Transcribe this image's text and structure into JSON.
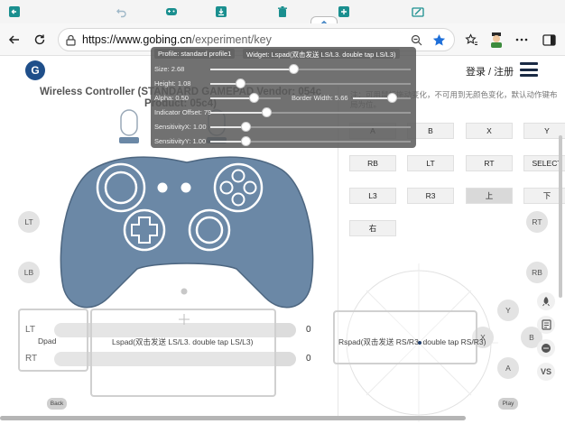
{
  "toolbar": {
    "icons": [
      "back-arrow-icon",
      "undo-icon",
      "gamepad-icon",
      "download-icon",
      "trash-icon",
      "add-icon",
      "edit-icon"
    ]
  },
  "browser": {
    "url_host": "https://www.gobing.cn",
    "url_path": "/experiment/key"
  },
  "site": {
    "logo": "G",
    "login": "登录 / 注册"
  },
  "device": {
    "title": "Wireless Controller (STANDARD GAMEPAD Vendor: 054c Product: 05c4)"
  },
  "panel": {
    "profile": "Profile: standard profile1",
    "widget": "Widget: Lspad(双击发送 LS/L3. double tap LS/L3)",
    "size": "Size: 2.68",
    "height": "Height: 1.08",
    "alpha": "Alpha: 0.50",
    "border_width": "Border Width: 5.66",
    "indicator_offset": "Indicator Offset: 79",
    "sensitivity_x": "SensitivityX: 1.00",
    "sensitivity_y": "SensitivityY: 1.00"
  },
  "hint": "注：可用鼠标拖动变化，不可用到无颜色变化，默认动作键布局为位。",
  "keys": {
    "a": "A",
    "b": "B",
    "x": "X",
    "y": "Y",
    "rb": "RB",
    "lt": "LT",
    "rt": "RT",
    "select": "SELECT",
    "l3": "L3",
    "r3": "R3",
    "up": "上",
    "down": "下",
    "right": "右"
  },
  "left_round": {
    "lt": "LT",
    "lb": "LB"
  },
  "right_round": {
    "rt": "RT",
    "rb": "RB"
  },
  "face": {
    "y": "Y",
    "x": "X",
    "b": "B",
    "a": "A"
  },
  "triggers": {
    "lt_label": "LT",
    "lt_value": "0",
    "rt_label": "RT",
    "rt_value": "0"
  },
  "zones": {
    "dpad": "Dpad",
    "lspad": "Lspad(双击发送 LS/L3. double tap LS/L3)",
    "rspad": "Rspad(双击发送 RS/R3. double tap RS/R3)"
  },
  "bottom": {
    "back": "Back",
    "play": "Play"
  },
  "side_tools": {
    "vs": "VS"
  },
  "colors": {
    "pad": "#6b88a6",
    "pad_stroke": "#ffffff",
    "panel": "#5a5a5a"
  }
}
